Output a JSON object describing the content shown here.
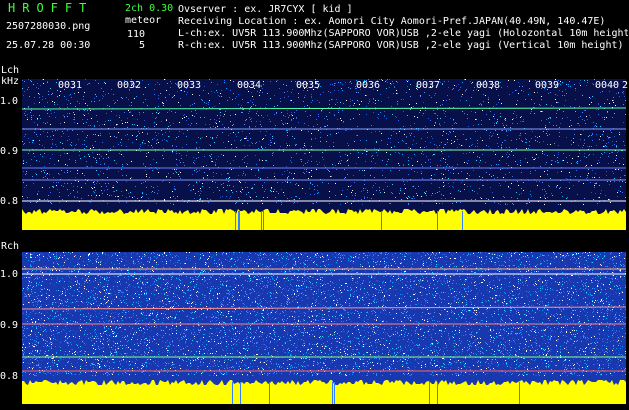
{
  "brand": "HROFFT",
  "filename": "2507280030.png",
  "datetime": "25.07.28 00:30",
  "channel_mode": "2ch 0.30",
  "meteor": {
    "label": "meteor",
    "count_l": "110",
    "count_r": "5"
  },
  "header": {
    "observer": "Ovserver                : ex. JR7CYX [ kid ]",
    "location": "Receiving Location : ex. Aomori City Aomori-Pref.JAPAN(40.49N, 140.47E)",
    "lch": "L-ch:ex. UV5R 113.900Mhz(SAPPORO VOR)USB ,2-ele yagi (Holozontal 10m height)",
    "rch": "R-ch:ex. UV5R 113.900Mhz(SAPPORO VOR)USB ,2-ele yagi (Vertical 10m height)"
  },
  "time_ticks": [
    "0031",
    "0032",
    "0033",
    "0034",
    "0035",
    "0036",
    "0037",
    "0038",
    "0039",
    "0040",
    "2"
  ],
  "lch_panel": {
    "name": "Lch",
    "unit": "kHz",
    "y_ticks": [
      "1.0",
      "0.9",
      "0.8"
    ]
  },
  "rch_panel": {
    "name": "Rch",
    "y_ticks": [
      "1.0",
      "0.9",
      "0.8"
    ]
  },
  "colors": {
    "label": "#3cff3c",
    "bg": "#000000",
    "spectrum": "#1a3cb4",
    "power": "#ffff00"
  }
}
